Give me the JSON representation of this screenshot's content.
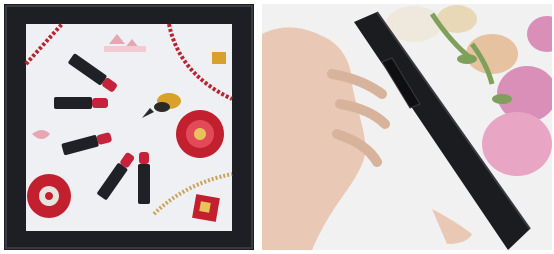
{
  "image": {
    "layout": "two-photo-collage",
    "panels": [
      {
        "subject": "framed-photo-frame-front",
        "frame_color": "#1e1f24",
        "content": "lipsticks-and-jewelry-flatlay"
      },
      {
        "subject": "frame-side-profile-held-in-hand",
        "frame_color": "#1b1c20",
        "background": "pink-roses-and-white-flowers"
      }
    ]
  },
  "colors": {
    "frame_black": "#1e1f24",
    "mat_background": "#eef0f3",
    "lipstick_red": "#c4233b",
    "jewel_red": "#c3202f",
    "rose_pink": "#d98fb8",
    "skin": "#e9c9b5",
    "leaf_green": "#7fa05a"
  }
}
